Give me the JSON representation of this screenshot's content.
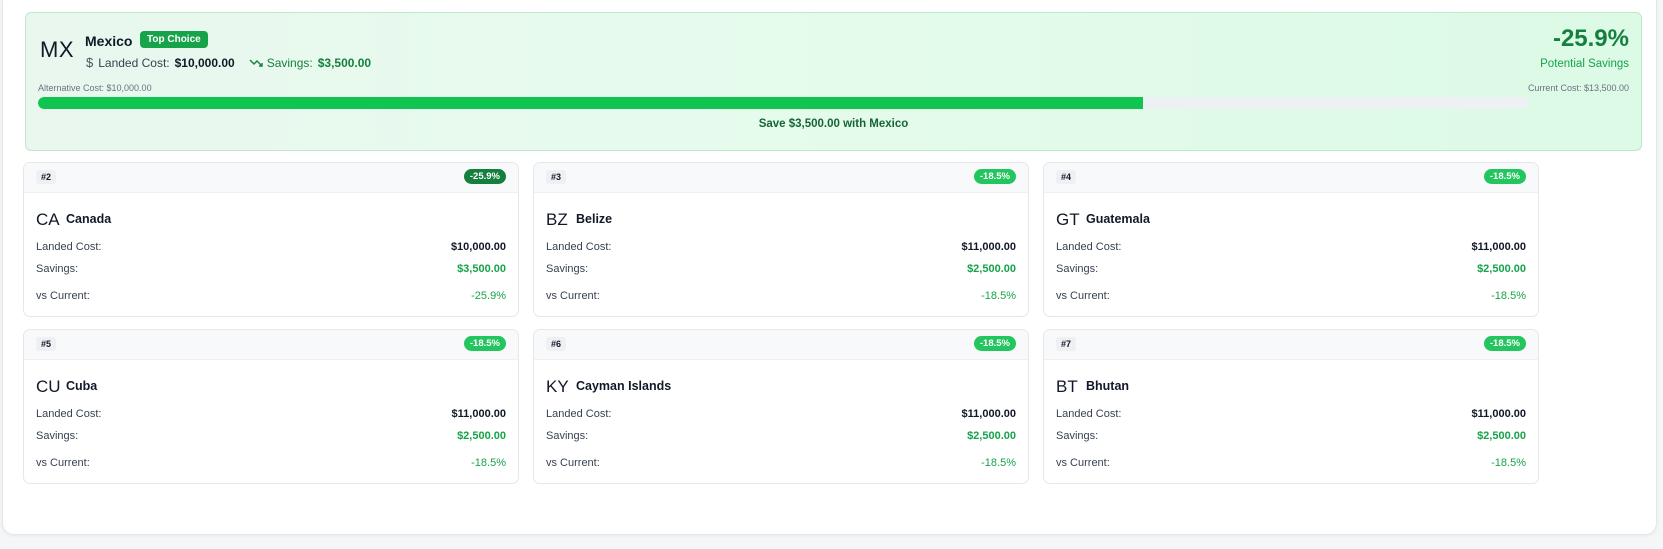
{
  "hero": {
    "code": "MX",
    "name": "Mexico",
    "badge": "Top Choice",
    "landed_label": "Landed Cost:",
    "landed_value": "$10,000.00",
    "savings_label": "Savings:",
    "savings_value": "$3,500.00",
    "percent": "-25.9%",
    "percent_label": "Potential Savings",
    "alt_cost_label": "Alternative Cost: $10,000.00",
    "current_cost_label": "Current Cost: $13,500.00",
    "progress_fraction": 0.741,
    "caption": "Save $3,500.00 with Mexico"
  },
  "labels": {
    "landed": "Landed Cost:",
    "savings": "Savings:",
    "vs_current": "vs Current:"
  },
  "cards": [
    {
      "rank": "#2",
      "badge": "-25.9%",
      "code": "CA",
      "name": "Canada",
      "landed": "$10,000.00",
      "savings": "$3,500.00",
      "vs_current": "-25.9%"
    },
    {
      "rank": "#3",
      "badge": "-18.5%",
      "code": "BZ",
      "name": "Belize",
      "landed": "$11,000.00",
      "savings": "$2,500.00",
      "vs_current": "-18.5%"
    },
    {
      "rank": "#4",
      "badge": "-18.5%",
      "code": "GT",
      "name": "Guatemala",
      "landed": "$11,000.00",
      "savings": "$2,500.00",
      "vs_current": "-18.5%"
    },
    {
      "rank": "#5",
      "badge": "-18.5%",
      "code": "CU",
      "name": "Cuba",
      "landed": "$11,000.00",
      "savings": "$2,500.00",
      "vs_current": "-18.5%"
    },
    {
      "rank": "#6",
      "badge": "-18.5%",
      "code": "KY",
      "name": "Cayman Islands",
      "landed": "$11,000.00",
      "savings": "$2,500.00",
      "vs_current": "-18.5%"
    },
    {
      "rank": "#7",
      "badge": "-18.5%",
      "code": "BT",
      "name": "Bhutan",
      "landed": "$11,000.00",
      "savings": "$2,500.00",
      "vs_current": "-18.5%"
    }
  ],
  "icons": {
    "landed": "dollar-icon",
    "savings": "trending-down-icon"
  },
  "colors": {
    "accent_green": "#16a34a",
    "bar_fill": "#0fc44f"
  }
}
